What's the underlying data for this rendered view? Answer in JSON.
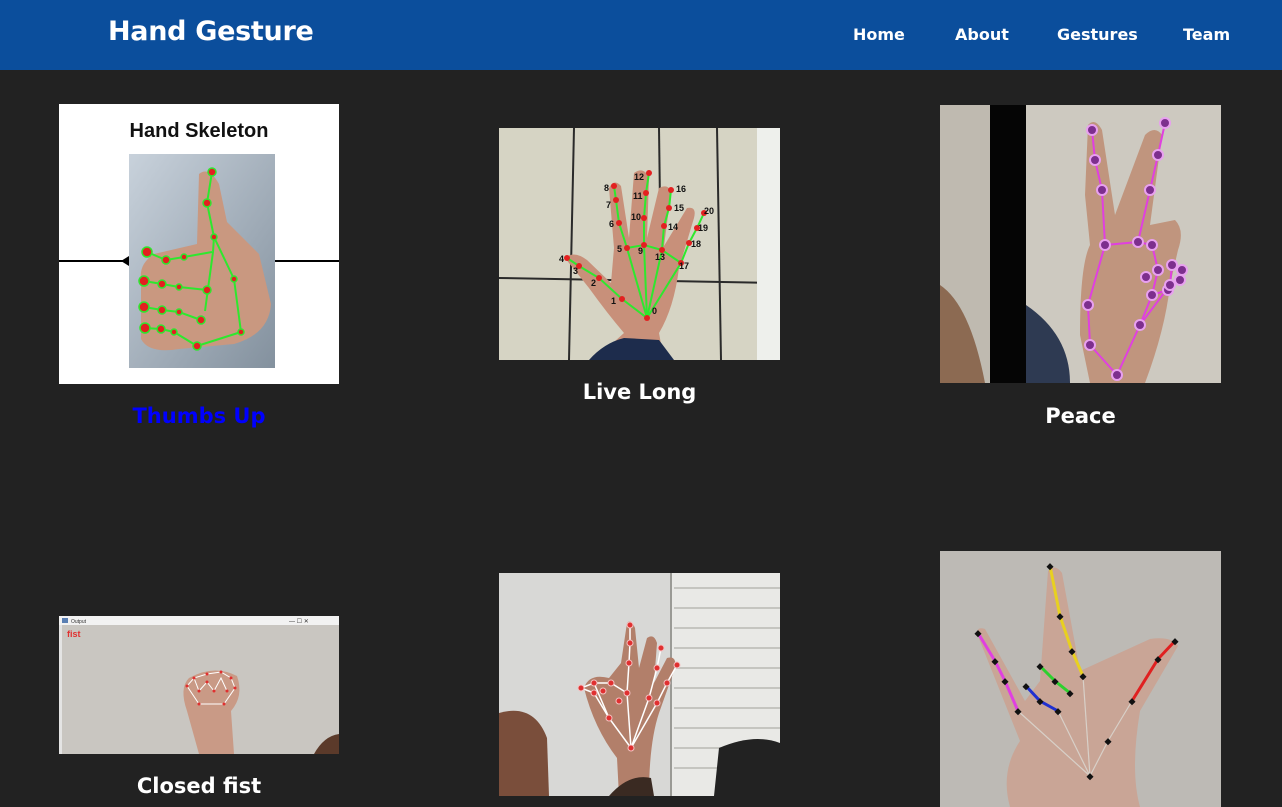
{
  "navbar": {
    "brand": "Hand Gesture",
    "links": [
      "Home",
      "About",
      "Gestures",
      "Team"
    ]
  },
  "gestures": [
    {
      "caption": "Thumbs Up",
      "image_heading": "Hand Skeleton",
      "caption_color": "#0000ff"
    },
    {
      "caption": "Live Long",
      "landmark_labels": [
        "0",
        "1",
        "2",
        "3",
        "4",
        "5",
        "6",
        "7",
        "8",
        "9",
        "10",
        "11",
        "12",
        "13",
        "14",
        "15",
        "16",
        "17",
        "18",
        "19",
        "20"
      ]
    },
    {
      "caption": "Peace"
    },
    {
      "caption": "Closed fist",
      "image_window_title": "Output",
      "image_overlay_label": "fist"
    },
    {
      "caption": ""
    },
    {
      "caption": ""
    }
  ],
  "colors": {
    "navbar": "#0b4e9c",
    "background": "#222222",
    "text": "#ffffff",
    "active_caption": "#0000ff"
  }
}
